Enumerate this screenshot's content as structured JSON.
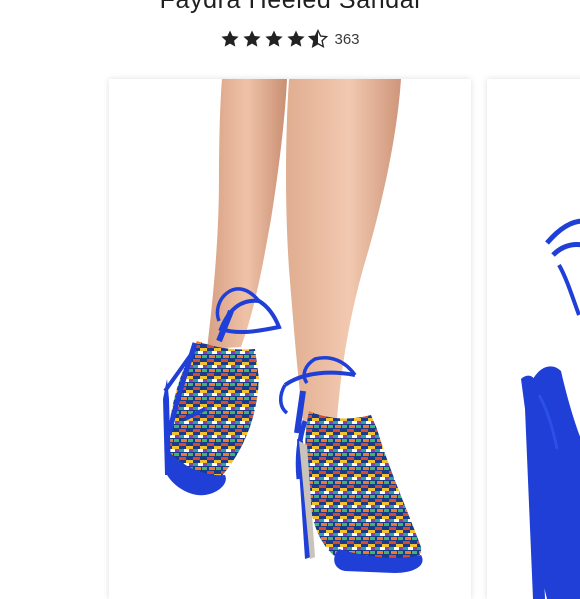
{
  "product": {
    "title": "Faydra Heeled Sandal",
    "rating": {
      "stars_filled": 4.5,
      "stars_total": 5,
      "review_count": "363"
    }
  },
  "colors": {
    "star": "#222222",
    "sandal_blue": "#1f3fd6",
    "skin": "#e7b59a"
  },
  "icons": {
    "star_full": "star-icon",
    "star_half": "half-star-icon"
  },
  "carousel": {
    "slides": [
      {
        "name": "main-product-image",
        "state": "active"
      },
      {
        "name": "next-product-image",
        "state": "partial"
      }
    ]
  }
}
